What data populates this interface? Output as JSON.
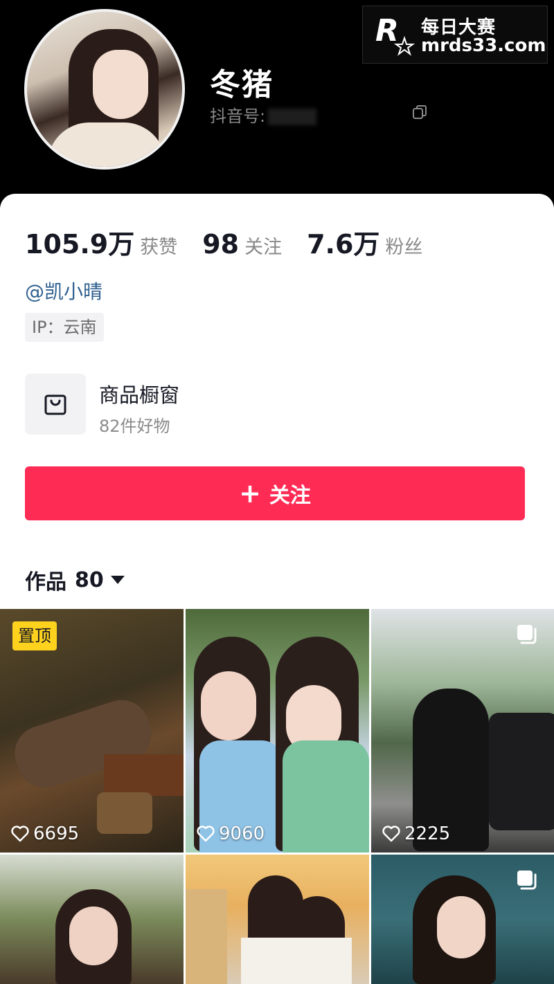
{
  "profile": {
    "nickname": "冬猪",
    "douyin_id_label": "抖音号:"
  },
  "watermark": {
    "line1": "每日大赛",
    "line2": "mrds33.com"
  },
  "stats": [
    {
      "value": "105.9万",
      "label": "获赞"
    },
    {
      "value": "98",
      "label": "关注"
    },
    {
      "value": "7.6万",
      "label": "粉丝"
    }
  ],
  "bio": {
    "mention": "@凯小晴",
    "ip": "IP：云南"
  },
  "shop": {
    "title": "商品橱窗",
    "subtitle": "82件好物"
  },
  "follow_button": {
    "plus": "+",
    "label": "关注"
  },
  "works": {
    "label": "作品",
    "count": "80"
  },
  "grid": [
    {
      "pinned_label": "置顶",
      "likes": "6695",
      "multi": false
    },
    {
      "likes": "9060",
      "multi": false
    },
    {
      "likes": "2225",
      "multi": true
    },
    {
      "multi": false
    },
    {
      "multi": false
    },
    {
      "multi": true
    }
  ],
  "colors": {
    "accent": "#fe2c55",
    "pin_badge": "#ffd21e",
    "mention": "#2e5f8f"
  }
}
